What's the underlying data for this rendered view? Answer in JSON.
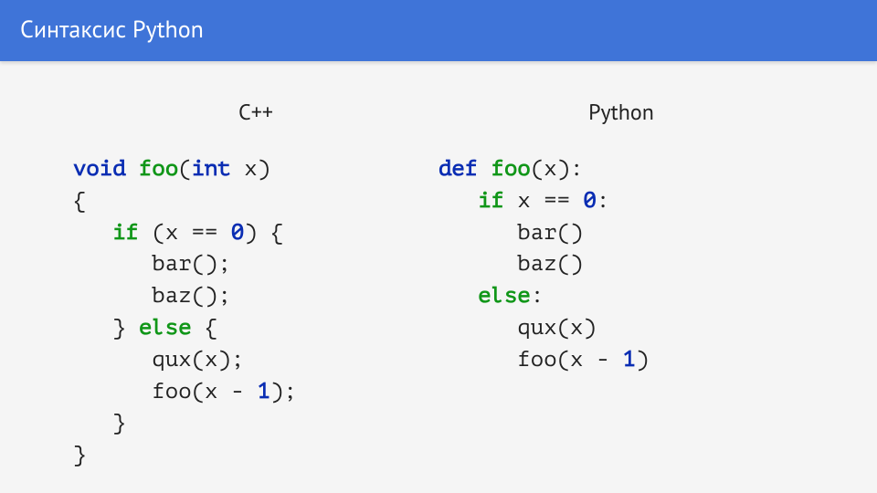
{
  "header": {
    "title": "Синтаксис Python"
  },
  "left": {
    "title": "C++",
    "code": {
      "kw_void": "void",
      "fn_foo": "foo",
      "kw_int": "int",
      "param_x": "x",
      "kw_if": "if",
      "cond_var": "x",
      "cond_op": "==",
      "cond_val": "0",
      "call_bar": "bar();",
      "call_baz": "baz();",
      "kw_else": "else",
      "call_qux": "qux(x);",
      "rec_fn": "foo",
      "rec_arg_pre": "(x - ",
      "rec_val": "1",
      "rec_arg_post": ");"
    }
  },
  "right": {
    "title": "Python",
    "code": {
      "kw_def": "def",
      "fn_foo": "foo",
      "param_x": "x",
      "kw_if": "if",
      "cond_var": "x",
      "cond_op": "==",
      "cond_val": "0",
      "call_bar": "bar()",
      "call_baz": "baz()",
      "kw_else": "else",
      "call_qux": "qux(x)",
      "rec_fn": "foo",
      "rec_arg_pre": "(x - ",
      "rec_val": "1",
      "rec_arg_post": ")"
    }
  }
}
